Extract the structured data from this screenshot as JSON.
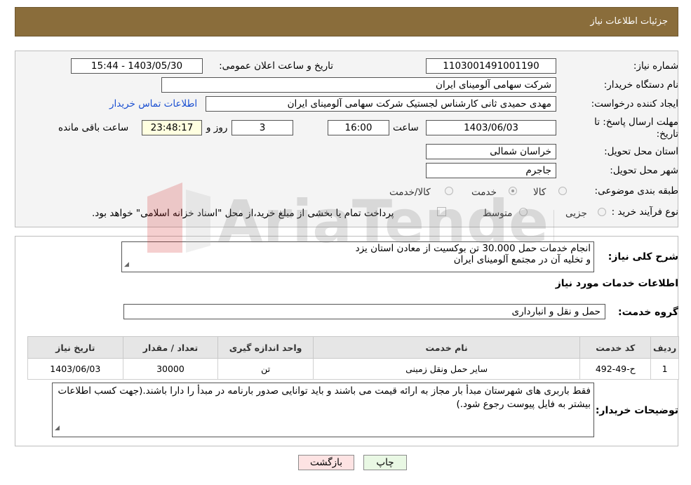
{
  "header": {
    "title": "جزئیات اطلاعات نیاز"
  },
  "fields": {
    "need_number": {
      "label": "شماره نیاز:",
      "value": "1103001491001190"
    },
    "announce_datetime": {
      "label": "تاریخ و ساعت اعلان عمومی:",
      "value": "1403/05/30 - 15:44"
    },
    "buyer_org": {
      "label": "نام دستگاه خریدار:",
      "value": "شرکت سهامی آلومینای ایران"
    },
    "requester": {
      "label": "ایجاد کننده درخواست:",
      "value": "مهدی حمیدی ثانی کارشناس لجستیک شرکت سهامی آلومینای ایران"
    },
    "contact_link": "اطلاعات تماس خریدار",
    "deadline": {
      "label_line1": "مهلت ارسال پاسخ: تا",
      "label_line2": "تاریخ:",
      "date": "1403/06/03",
      "time_label": "ساعت",
      "time": "16:00",
      "days": "3",
      "days_label": "روز و",
      "remaining": "23:48:17",
      "remaining_label": "ساعت باقی مانده"
    },
    "delivery_province": {
      "label": "استان محل تحویل:",
      "value": "خراسان شمالی"
    },
    "delivery_city": {
      "label": "شهر محل تحویل:",
      "value": "جاجرم"
    },
    "category": {
      "label": "طبقه بندی موضوعی:",
      "options": [
        "کالا",
        "خدمت",
        "کالا/خدمت"
      ],
      "selected": "خدمت"
    },
    "purchase_type": {
      "label": "نوع فرآیند خرید :",
      "options": [
        "جزیی",
        "متوسط"
      ],
      "selected": "",
      "payment_note": "پرداخت تمام یا بخشی از مبلغ خرید،از محل \"اسناد خزانه اسلامی\" خواهد بود."
    }
  },
  "summary": {
    "label": "شرح کلی نیاز:",
    "text_line1": "انجام خدمات حمل 30.000 تن بوکسیت از معادن استان یزد",
    "text_line2": "و تخلیه آن در مجتمع آلومینای ایران"
  },
  "services": {
    "section_title": "اطلاعات خدمات مورد نیاز",
    "group_label": "گروه خدمت:",
    "group_value": "حمل و نقل و انبارداری",
    "table": {
      "columns": [
        "ردیف",
        "کد خدمت",
        "نام خدمت",
        "واحد اندازه گیری",
        "تعداد / مقدار",
        "تاریخ نیاز"
      ],
      "rows": [
        [
          "1",
          "ح-49-492",
          "سایر حمل ونقل زمینی",
          "تن",
          "30000",
          "1403/06/03"
        ]
      ]
    }
  },
  "buyer_notes": {
    "label": "توضیحات خریدار:",
    "text": "فقط باربری های شهرستان مبدأ بار مجاز به ارائه قیمت می باشند و باید توانایی صدور بارنامه در مبدأ را دارا باشند.(جهت کسب اطلاعات بیشتر به فایل پیوست رجوع شود.)"
  },
  "buttons": {
    "print": "چاپ",
    "back": "بازگشت"
  },
  "watermark": {
    "text": "AriaTender.neT"
  },
  "colors": {
    "header_bg": "#8a6d3b",
    "link": "#1a4fd1",
    "back_btn": "#fde3e3",
    "print_btn": "#e9f8e4"
  }
}
